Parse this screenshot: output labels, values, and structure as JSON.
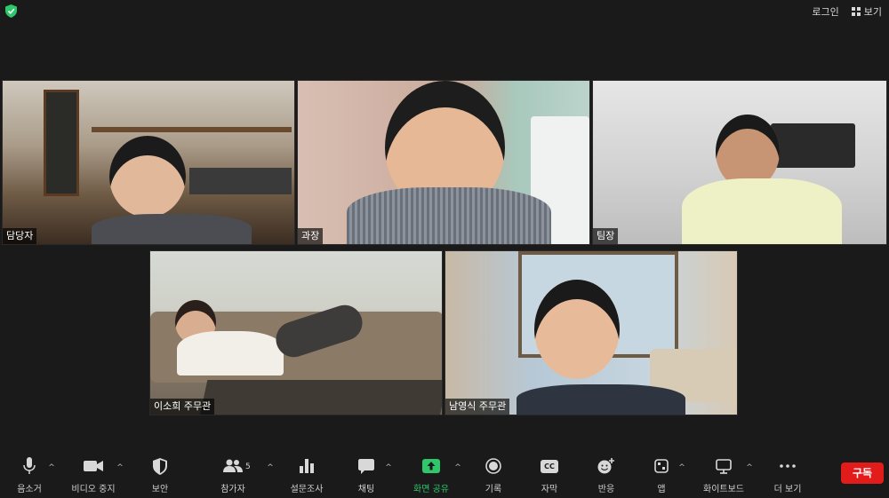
{
  "topbar": {
    "login_label": "로그인",
    "view_label": "보기"
  },
  "participants": [
    {
      "name": "담당자"
    },
    {
      "name": "과장"
    },
    {
      "name": "팀장"
    },
    {
      "name": "이소희 주무관"
    },
    {
      "name": "남영식 주무관"
    }
  ],
  "toolbar": {
    "mute": "음소거",
    "stop_video": "비디오 중지",
    "security": "보안",
    "participants": "참가자",
    "participants_count": "5",
    "polls": "설문조사",
    "chat": "채팅",
    "share_screen": "화면 공유",
    "record": "기록",
    "captions": "자막",
    "reactions": "반응",
    "apps": "앱",
    "whiteboard": "화이트보드",
    "more": "더 보기",
    "cc_glyph": "CC"
  },
  "overlay": {
    "subscribe": "구독"
  },
  "colors": {
    "accent_green": "#2ec76a",
    "subscribe_red": "#e21b1b",
    "shield_green": "#2ec76a"
  }
}
